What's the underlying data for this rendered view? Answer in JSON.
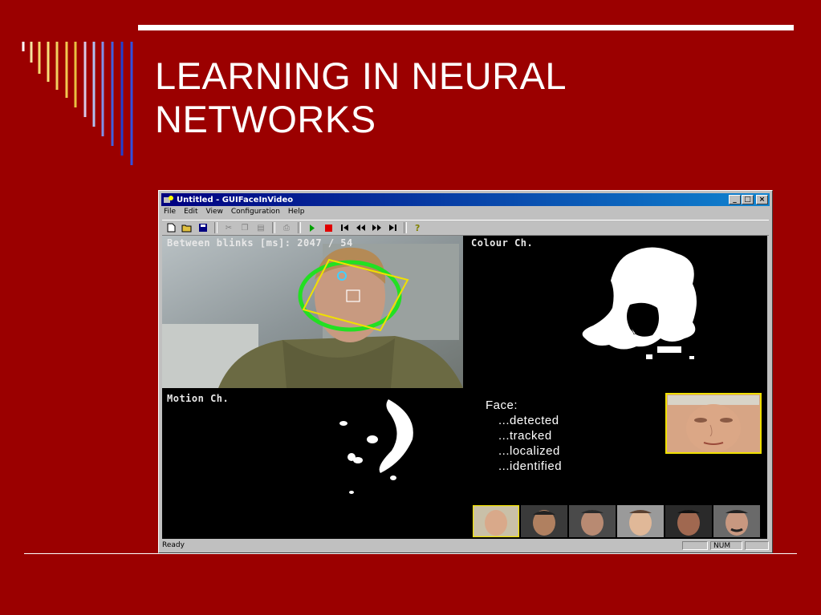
{
  "slide": {
    "title_line1": "LEARNING IN NEURAL",
    "title_line2": "NETWORKS",
    "colors": {
      "background": "#9b0000",
      "title": "#ffffff"
    }
  },
  "window": {
    "title": "Untitled - GUIFaceInVideo",
    "buttons": {
      "minimize": "_",
      "maximize": "□",
      "close": "×"
    },
    "menu": [
      "File",
      "Edit",
      "View",
      "Configuration",
      "Help"
    ],
    "toolbar_icons": [
      "new-icon",
      "open-icon",
      "save-icon",
      "cut-icon",
      "copy-icon",
      "paste-icon",
      "print-icon",
      "play-icon",
      "stop-icon",
      "skip-start-icon",
      "rewind-icon",
      "fast-forward-icon",
      "skip-end-icon",
      "help-icon"
    ],
    "panes": {
      "camera_label": "Between blinks [ms]: 2047 / 54",
      "colour_label": "Colour Ch.",
      "motion_label": "Motion Ch.",
      "face_lines": [
        "Face:",
        "...detected",
        "...tracked",
        "...localized",
        "...identified"
      ]
    },
    "status": {
      "ready": "Ready",
      "num": "NUM"
    }
  }
}
